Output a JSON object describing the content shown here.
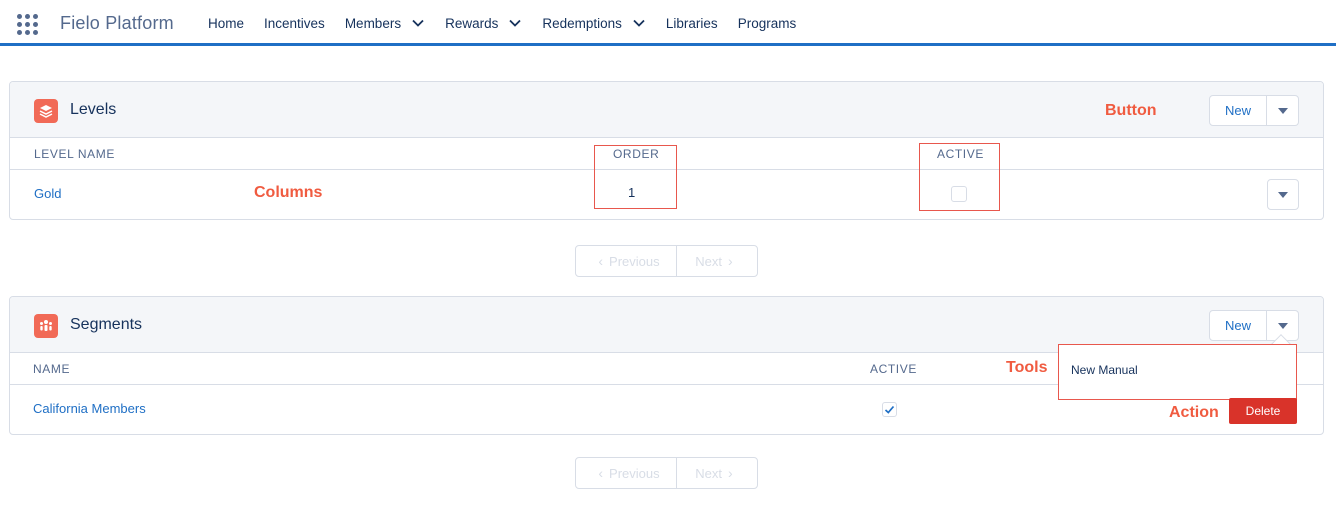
{
  "app": {
    "name": "Fielo Platform"
  },
  "nav": [
    {
      "label": "Home",
      "has_menu": false
    },
    {
      "label": "Incentives",
      "has_menu": false
    },
    {
      "label": "Members",
      "has_menu": true
    },
    {
      "label": "Rewards",
      "has_menu": true
    },
    {
      "label": "Redemptions",
      "has_menu": true
    },
    {
      "label": "Libraries",
      "has_menu": false
    },
    {
      "label": "Programs",
      "has_menu": false
    }
  ],
  "levels": {
    "title": "Levels",
    "new_label": "New",
    "columns": {
      "name": "LEVEL NAME",
      "order": "ORDER",
      "active": "ACTIVE"
    },
    "rows": [
      {
        "name": "Gold",
        "order": "1",
        "active": false
      }
    ],
    "pager": {
      "previous": "Previous",
      "next": "Next"
    }
  },
  "segments": {
    "title": "Segments",
    "new_label": "New",
    "columns": {
      "name": "NAME",
      "active": "ACTIVE"
    },
    "rows": [
      {
        "name": "California Members",
        "active": true
      }
    ],
    "pager": {
      "previous": "Previous",
      "next": "Next"
    },
    "dropdown_items": [
      "New Manual"
    ],
    "delete_label": "Delete"
  },
  "annotations": {
    "button": "Button",
    "columns": "Columns",
    "tools": "Tools",
    "action": "Action"
  },
  "colors": {
    "accent": "#1f6fc5",
    "annotation": "#f05b40",
    "card_icon": "#f16a57",
    "delete": "#d9332a"
  }
}
